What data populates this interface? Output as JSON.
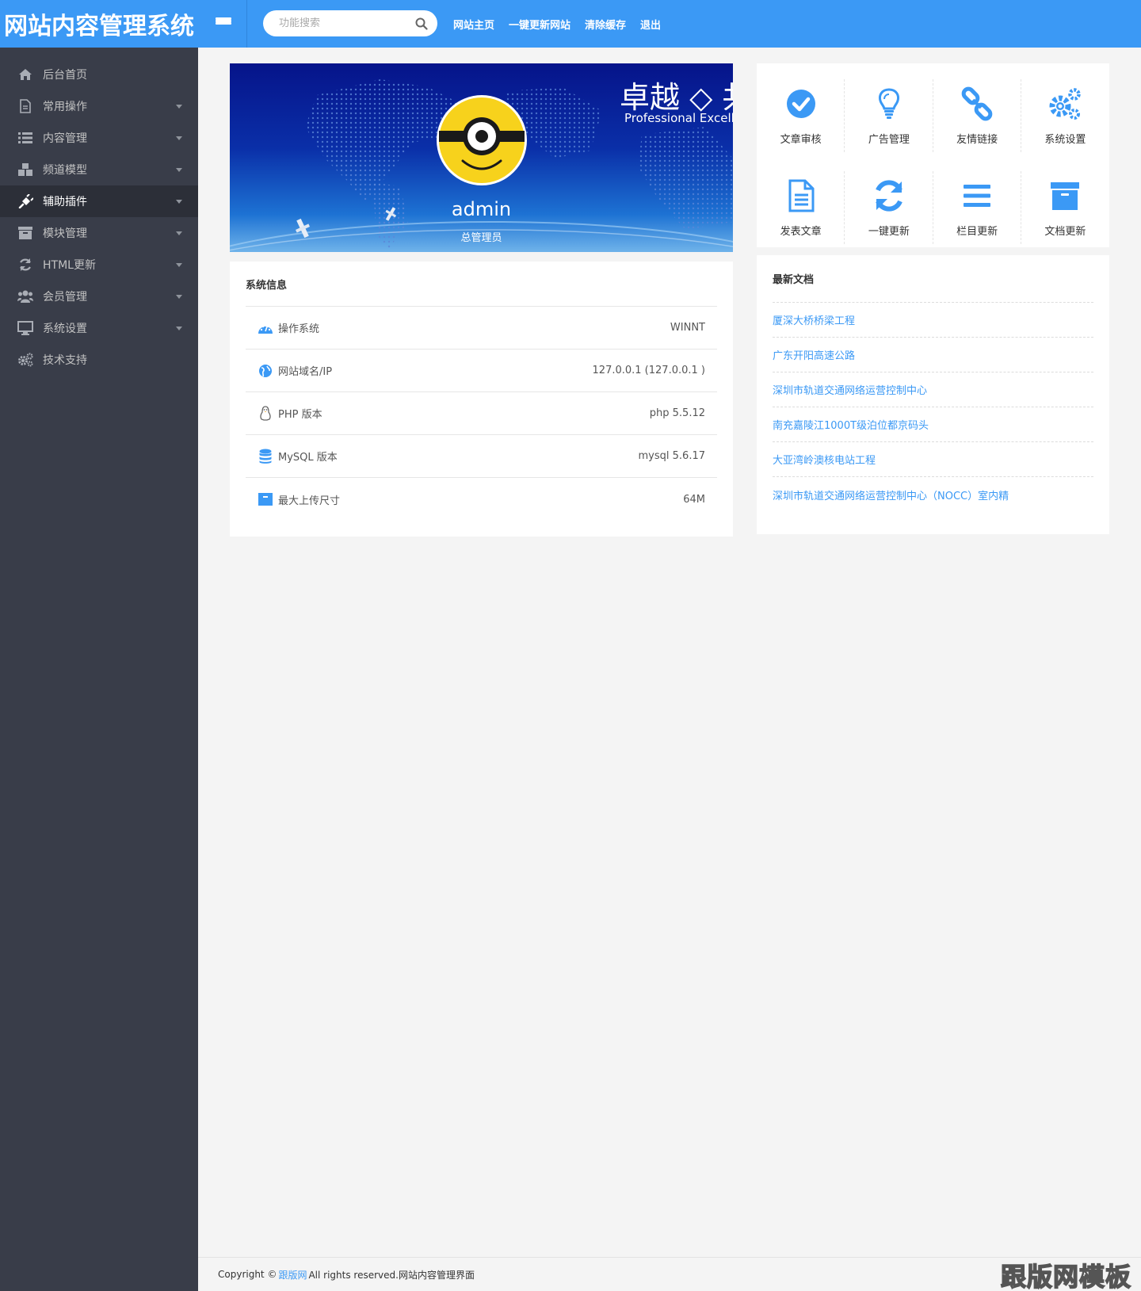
{
  "header": {
    "logo": "网站内容管理系统",
    "search_placeholder": "功能搜索",
    "links": [
      "网站主页",
      "一键更新网站",
      "清除缓存",
      "退出"
    ]
  },
  "sidebar": {
    "items": [
      {
        "label": "后台首页",
        "icon": "home-icon",
        "has_caret": false
      },
      {
        "label": "常用操作",
        "icon": "document-icon",
        "has_caret": true
      },
      {
        "label": "内容管理",
        "icon": "list-icon",
        "has_caret": true
      },
      {
        "label": "频道模型",
        "icon": "cubes-icon",
        "has_caret": true
      },
      {
        "label": "辅助插件",
        "icon": "plug-icon",
        "has_caret": true,
        "active": true
      },
      {
        "label": "模块管理",
        "icon": "archive-icon",
        "has_caret": true
      },
      {
        "label": "HTML更新",
        "icon": "refresh-icon",
        "has_caret": true
      },
      {
        "label": "会员管理",
        "icon": "users-icon",
        "has_caret": true
      },
      {
        "label": "系统设置",
        "icon": "desktop-icon",
        "has_caret": true
      },
      {
        "label": "技术支持",
        "icon": "gears-icon",
        "has_caret": false
      }
    ]
  },
  "banner": {
    "slogan": "卓越 ◇ 共",
    "slogan_en": "Professional Excellenc",
    "username": "admin",
    "role": "总管理员"
  },
  "quick_actions": [
    {
      "label": "文章审核",
      "icon": "check-circle-icon"
    },
    {
      "label": "广告管理",
      "icon": "lightbulb-icon"
    },
    {
      "label": "友情链接",
      "icon": "link-icon"
    },
    {
      "label": "系统设置",
      "icon": "gears-icon"
    },
    {
      "label": "发表文章",
      "icon": "file-text-icon"
    },
    {
      "label": "一键更新",
      "icon": "refresh-icon"
    },
    {
      "label": "栏目更新",
      "icon": "bars-icon"
    },
    {
      "label": "文档更新",
      "icon": "archive-icon"
    }
  ],
  "system_info": {
    "title": "系统信息",
    "rows": [
      {
        "label": "操作系统",
        "value": "WINNT",
        "icon": "dashboard-icon"
      },
      {
        "label": "网站域名/IP",
        "value": "127.0.0.1 (127.0.0.1 )",
        "icon": "globe-icon"
      },
      {
        "label": "PHP 版本",
        "value": "php 5.5.12",
        "icon": "linux-icon"
      },
      {
        "label": "MySQL 版本",
        "value": "mysql 5.6.17",
        "icon": "database-icon"
      },
      {
        "label": "最大上传尺寸",
        "value": "64M",
        "icon": "archive-icon"
      }
    ]
  },
  "latest_docs": {
    "title": "最新文档",
    "items": [
      "厦深大桥桥梁工程",
      "广东开阳高速公路",
      "深圳市轨道交通网络运营控制中心",
      "南充嘉陵江1000T级泊位都京码头",
      "大亚湾岭澳核电站工程",
      "深圳市轨道交通网络运营控制中心（NOCC）室内精"
    ]
  },
  "footer": {
    "prefix": "Copyright ©",
    "link": "跟版网",
    "suffix": "All rights reserved.网站内容管理界面",
    "watermark": "跟版网模板"
  },
  "colors": {
    "accent": "#3b99f5",
    "sidebar_bg": "#393d49",
    "sidebar_active": "#2c2f38"
  }
}
